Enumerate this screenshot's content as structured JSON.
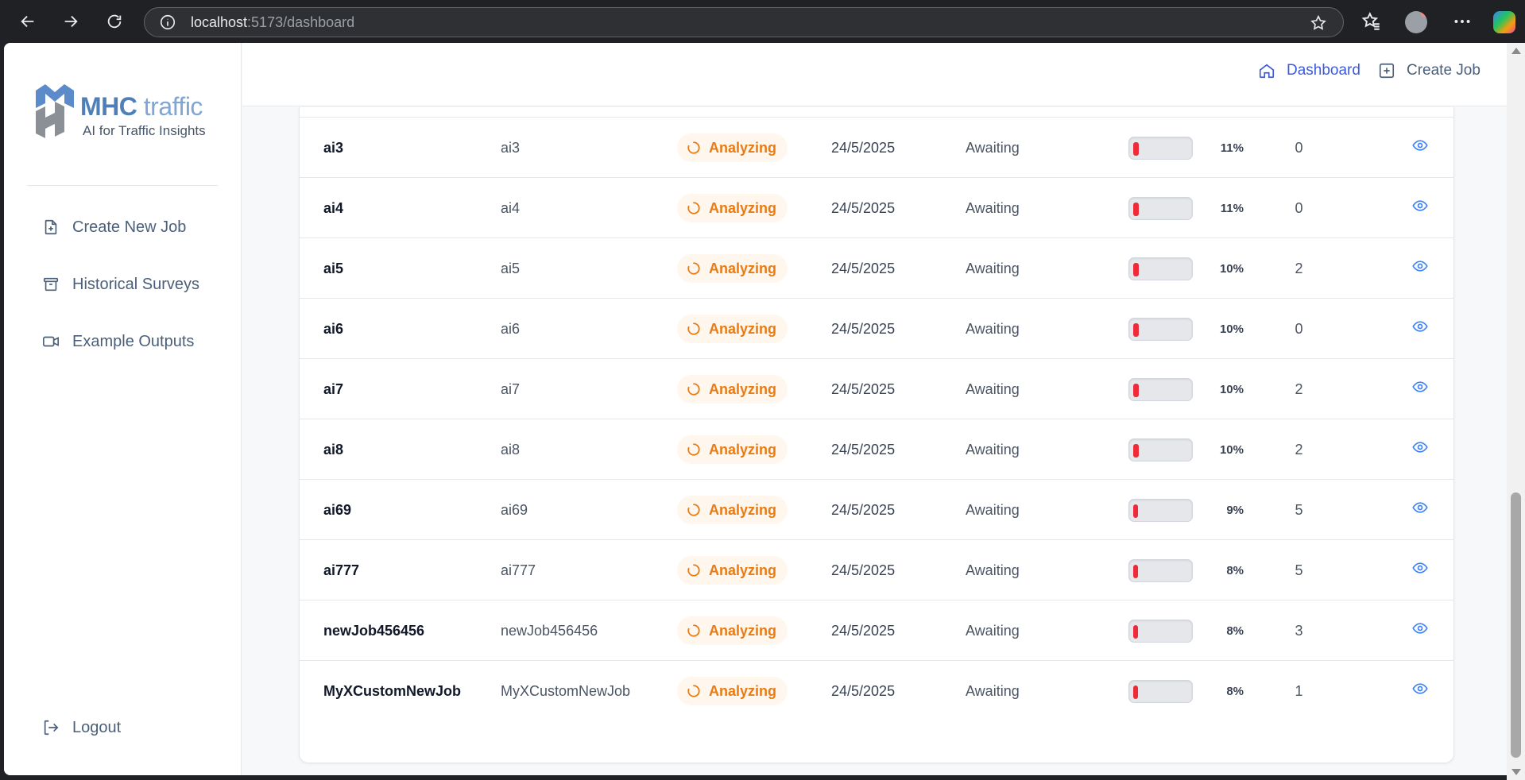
{
  "browser": {
    "url_host": "localhost",
    "url_path": ":5173/dashboard"
  },
  "sidebar": {
    "logo": {
      "brand_bold": "MHC ",
      "brand_light": "traffic",
      "tagline": "AI for Traffic Insights"
    },
    "items": [
      {
        "label": "Create New Job",
        "icon": "file-plus-icon"
      },
      {
        "label": "Historical Surveys",
        "icon": "archive-icon"
      },
      {
        "label": "Example Outputs",
        "icon": "video-icon"
      }
    ],
    "logout": {
      "label": "Logout",
      "icon": "logout-icon"
    }
  },
  "topbar": {
    "dashboard_label": "Dashboard",
    "create_job_label": "Create Job"
  },
  "colors": {
    "accent": "#3b5bdb",
    "status_analyzing": "#ea7a12",
    "progress_fill": "#ef2b3a",
    "view_icon": "#3b82f6"
  },
  "table": {
    "rows": [
      {
        "name": "ai3",
        "desc": "ai3",
        "status": "Analyzing",
        "date": "24/5/2025",
        "state": "Awaiting",
        "progress": 11,
        "progress_label": "11%",
        "count": "0"
      },
      {
        "name": "ai4",
        "desc": "ai4",
        "status": "Analyzing",
        "date": "24/5/2025",
        "state": "Awaiting",
        "progress": 11,
        "progress_label": "11%",
        "count": "0"
      },
      {
        "name": "ai5",
        "desc": "ai5",
        "status": "Analyzing",
        "date": "24/5/2025",
        "state": "Awaiting",
        "progress": 10,
        "progress_label": "10%",
        "count": "2"
      },
      {
        "name": "ai6",
        "desc": "ai6",
        "status": "Analyzing",
        "date": "24/5/2025",
        "state": "Awaiting",
        "progress": 10,
        "progress_label": "10%",
        "count": "0"
      },
      {
        "name": "ai7",
        "desc": "ai7",
        "status": "Analyzing",
        "date": "24/5/2025",
        "state": "Awaiting",
        "progress": 10,
        "progress_label": "10%",
        "count": "2"
      },
      {
        "name": "ai8",
        "desc": "ai8",
        "status": "Analyzing",
        "date": "24/5/2025",
        "state": "Awaiting",
        "progress": 10,
        "progress_label": "10%",
        "count": "2"
      },
      {
        "name": "ai69",
        "desc": "ai69",
        "status": "Analyzing",
        "date": "24/5/2025",
        "state": "Awaiting",
        "progress": 9,
        "progress_label": "9%",
        "count": "5"
      },
      {
        "name": "ai777",
        "desc": "ai777",
        "status": "Analyzing",
        "date": "24/5/2025",
        "state": "Awaiting",
        "progress": 8,
        "progress_label": "8%",
        "count": "5"
      },
      {
        "name": "newJob456456",
        "desc": "newJob456456",
        "status": "Analyzing",
        "date": "24/5/2025",
        "state": "Awaiting",
        "progress": 8,
        "progress_label": "8%",
        "count": "3"
      },
      {
        "name": "MyXCustomNewJob",
        "desc": "MyXCustomNewJob",
        "status": "Analyzing",
        "date": "24/5/2025",
        "state": "Awaiting",
        "progress": 8,
        "progress_label": "8%",
        "count": "1"
      }
    ]
  }
}
